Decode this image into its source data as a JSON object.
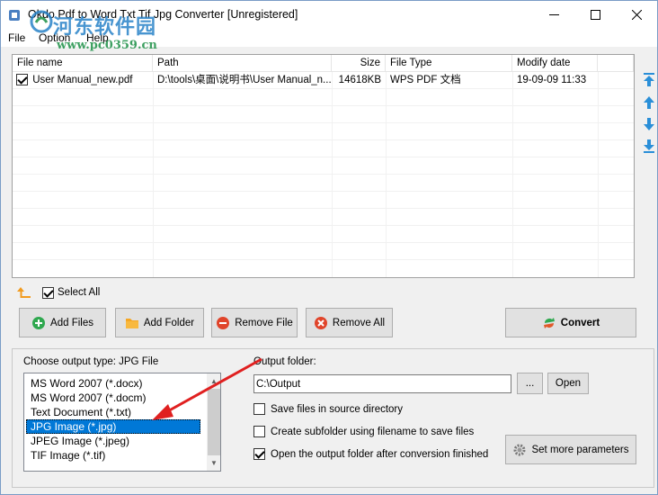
{
  "window": {
    "title": "Okdo Pdf to Word Txt Tif Jpg Converter [Unregistered]"
  },
  "watermark": {
    "text": "河东软件园",
    "url": "www.pc0359.cn"
  },
  "menubar": {
    "file": "File",
    "option": "Option",
    "help": "Help"
  },
  "file_list": {
    "columns": [
      "File name",
      "Path",
      "Size",
      "File Type",
      "Modify date"
    ],
    "rows": [
      {
        "checked": true,
        "name": "User Manual_new.pdf",
        "path": "D:\\tools\\桌面\\说明书\\User Manual_n...",
        "size": "14618KB",
        "type": "WPS PDF 文档",
        "modified": "19-09-09 11:33"
      }
    ]
  },
  "side_buttons": [
    "move-to-top-icon",
    "move-up-icon",
    "move-down-icon",
    "move-to-bottom-icon"
  ],
  "select_all": {
    "label": "Select All",
    "checked": true
  },
  "buttons": {
    "add_files": "Add Files",
    "add_folder": "Add Folder",
    "remove_file": "Remove File",
    "remove_all": "Remove All",
    "convert": "Convert",
    "browse": "...",
    "open": "Open",
    "set_params": "Set more parameters"
  },
  "output": {
    "type_label": "Choose output type:  JPG File",
    "types": [
      "MS Word 2007 (*.docx)",
      "MS Word 2007 (*.docm)",
      "Text Document (*.txt)",
      "JPG Image (*.jpg)",
      "JPEG Image (*.jpeg)",
      "TIF Image (*.tif)"
    ],
    "selected_index": 3,
    "folder_label": "Output folder:",
    "folder_value": "C:\\Output",
    "options": [
      {
        "label": "Save files in source directory",
        "checked": false
      },
      {
        "label": "Create subfolder using filename to save files",
        "checked": false
      },
      {
        "label": "Open the output folder after conversion finished",
        "checked": true
      }
    ]
  },
  "colors": {
    "selection": "#0078d7",
    "arrow_blue": "#2a8fd8",
    "annotation_red": "#e02020"
  }
}
